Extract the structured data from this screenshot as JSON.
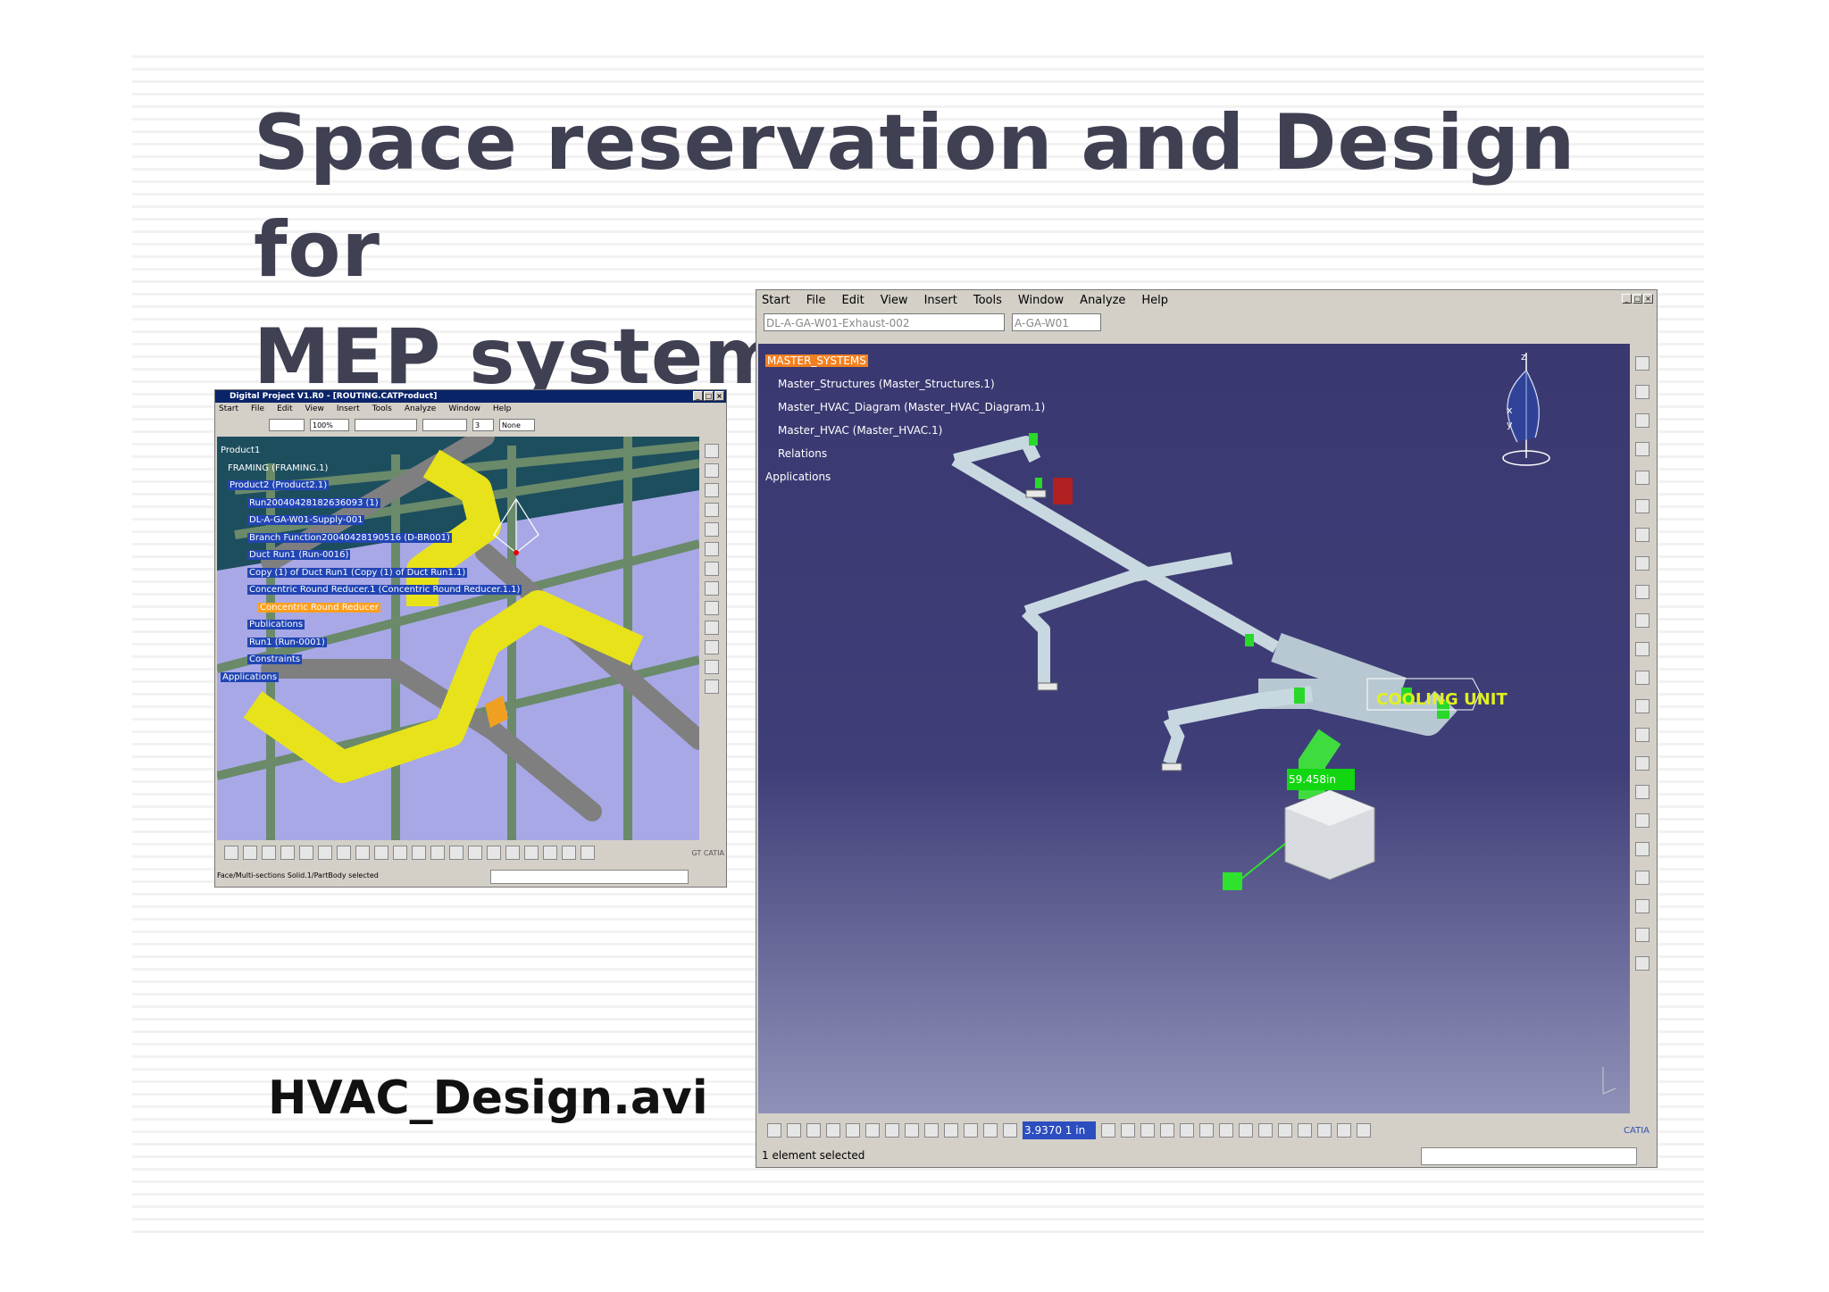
{
  "slide": {
    "title_line1": "Space reservation and Design for",
    "title_line2": "MEP systems & equipment",
    "caption": "HVAC_Design.avi"
  },
  "small_window": {
    "title": "Digital Project V1.R0 - [ROUTING.CATProduct]",
    "menu": [
      "Start",
      "File",
      "Edit",
      "View",
      "Insert",
      "Tools",
      "Analyze",
      "Window",
      "Help"
    ],
    "toolbar": {
      "zoom": "100%",
      "count": "3",
      "none_label": "None"
    },
    "tree": [
      "Product1",
      "FRAMING (FRAMING.1)",
      "Product2 (Product2.1)",
      "Run20040428182636093 (1)",
      "DL-A-GA-W01-Supply-001",
      "Branch Function20040428190516 (D-BR001)",
      "Duct Run1 (Run-0016)",
      "Copy (1) of Duct Run1 (Copy (1) of Duct Run1.1)",
      "Concentric Round Reducer.1 (Concentric Round Reducer.1.1)",
      "Concentric Round Reducer",
      "Publications",
      "Run1 (Run-0001)",
      "Constraints",
      "Applications"
    ],
    "status": "Face/Multi-sections Solid.1/PartBody selected",
    "brand": "GT CATIA"
  },
  "big_window": {
    "menu": [
      "Start",
      "File",
      "Edit",
      "View",
      "Insert",
      "Tools",
      "Window",
      "Analyze",
      "Help"
    ],
    "combo1": "DL-A-GA-W01-Exhaust-002",
    "combo2": "A-GA-W01",
    "tree": [
      "MASTER_SYSTEMS",
      "Master_Structures (Master_Structures.1)",
      "Master_HVAC_Diagram (Master_HVAC_Diagram.1)",
      "Master_HVAC (Master_HVAC.1)",
      "Relations",
      "Applications"
    ],
    "label_cooling": "COOLING UNIT",
    "dimension": "59.458in",
    "zoom_value": "3.9370 1 in",
    "status": "1 element selected",
    "brand": "CATIA",
    "axis_z": "z",
    "axis_x": "x",
    "axis_y": "y"
  }
}
